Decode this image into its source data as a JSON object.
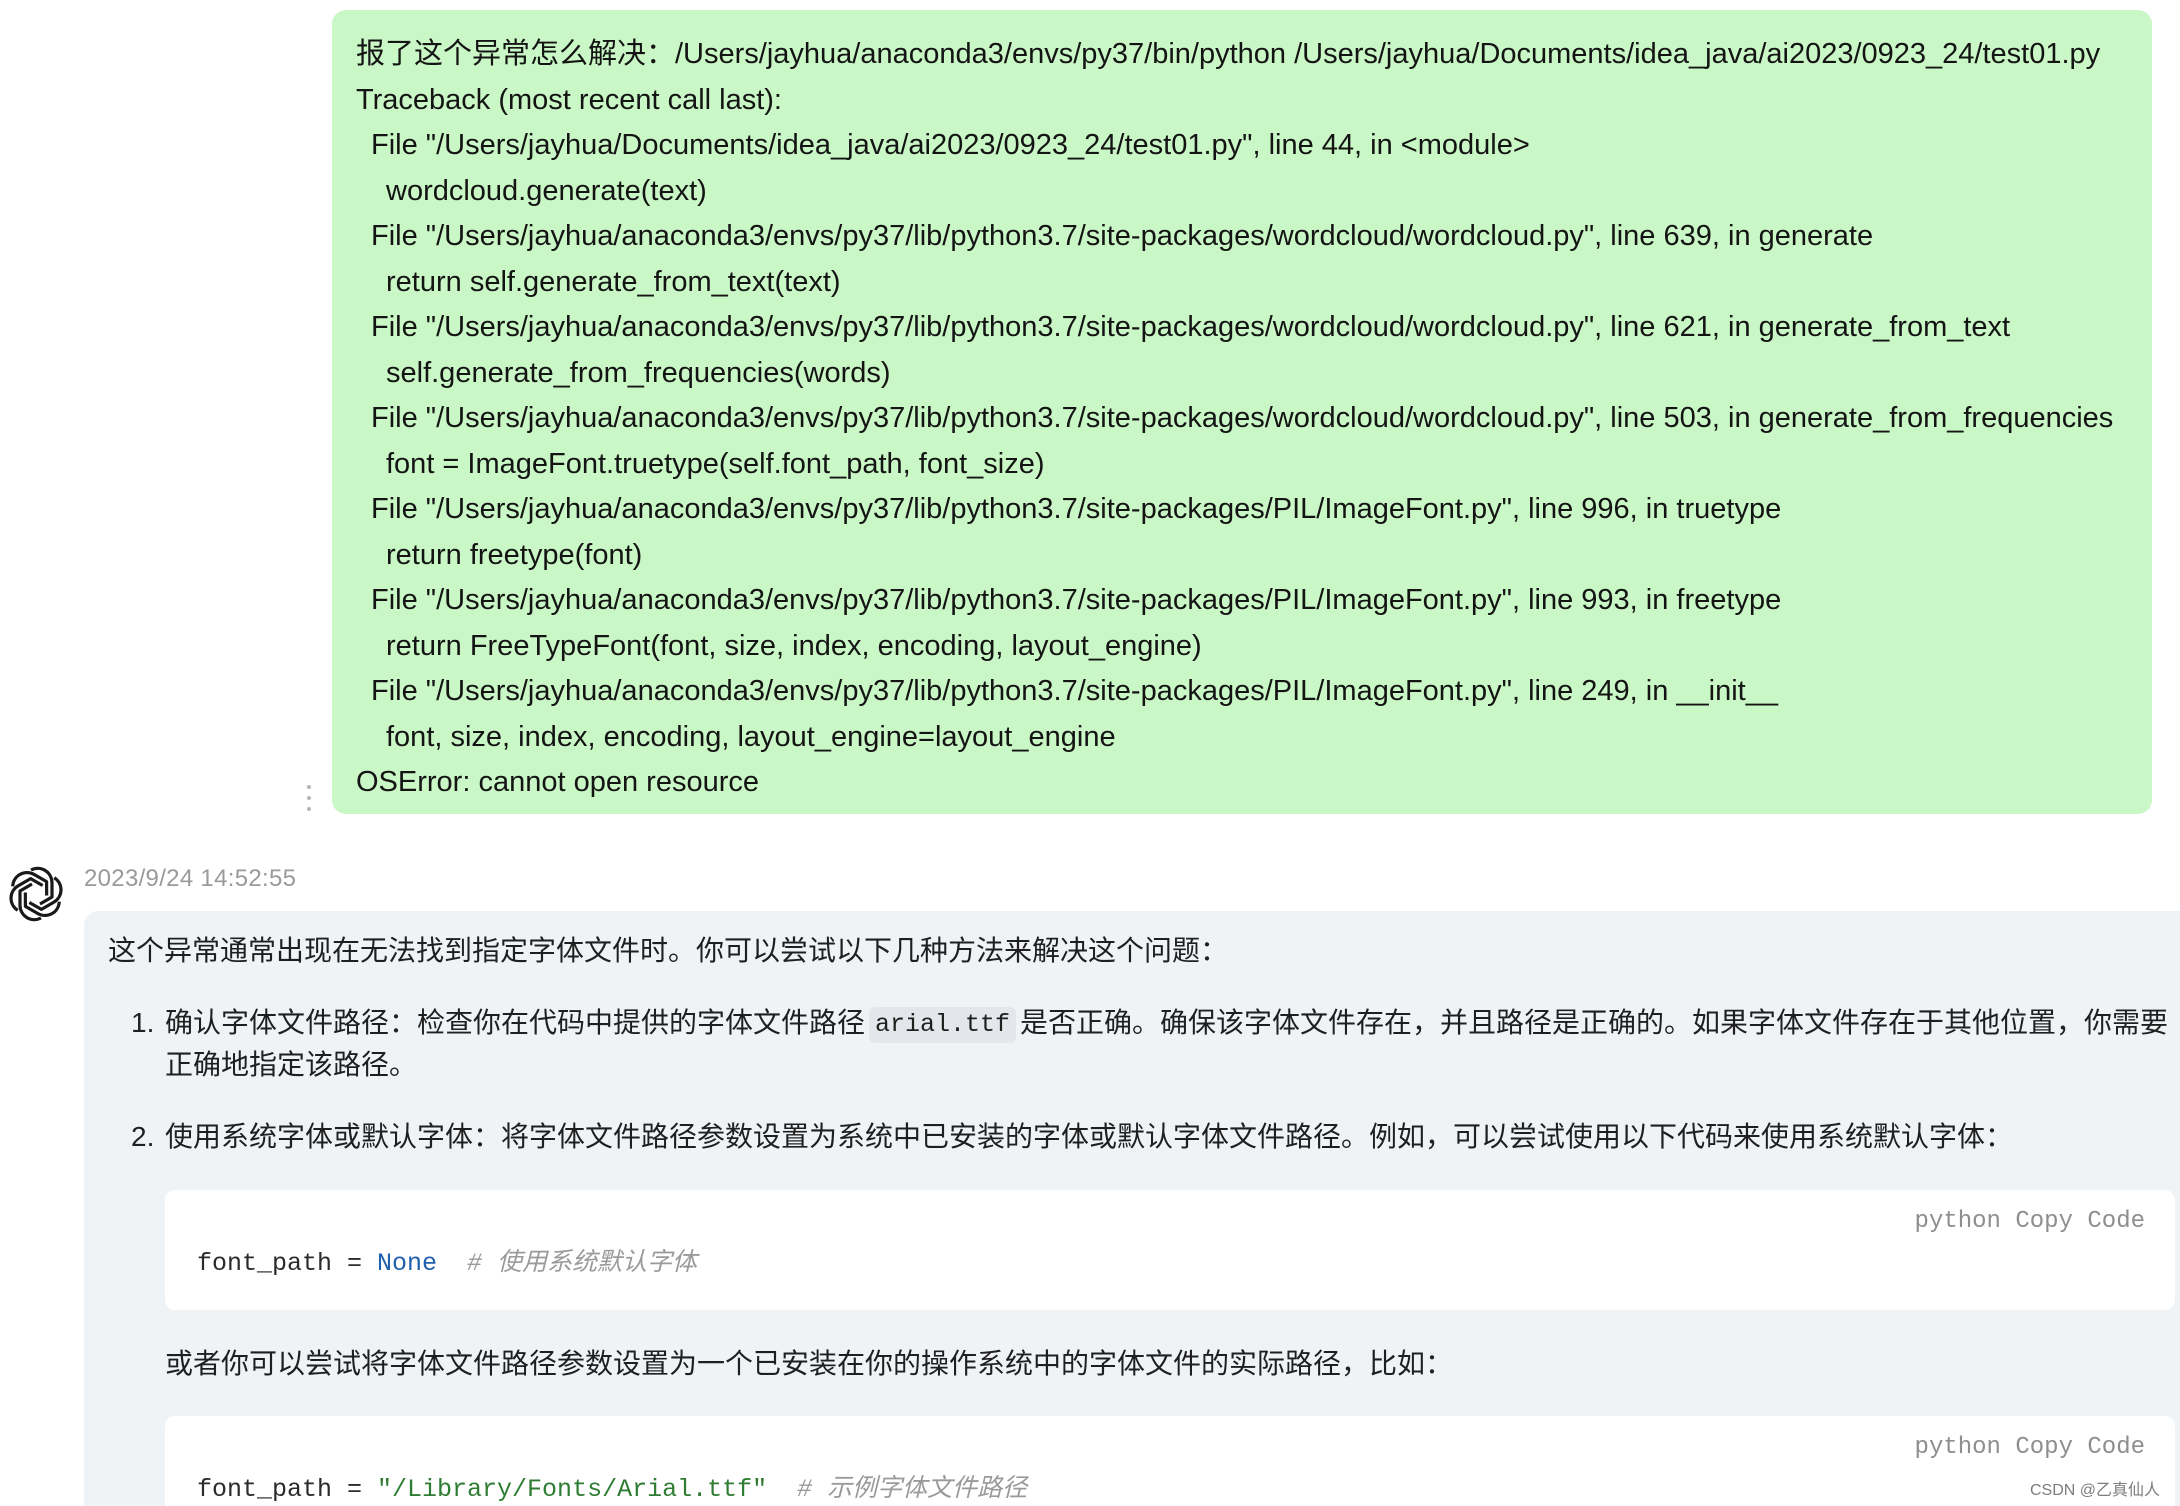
{
  "user_message": {
    "lines": [
      "报了这个异常怎么解决：/Users/jayhua/anaconda3/envs/py37/bin/python /Users/jayhua/Documents/idea_java/ai2023/0923_24/test01.py",
      "Traceback (most recent call last):",
      "File \"/Users/jayhua/Documents/idea_java/ai2023/0923_24/test01.py\", line 44, in <module>",
      "wordcloud.generate(text)",
      "File \"/Users/jayhua/anaconda3/envs/py37/lib/python3.7/site-packages/wordcloud/wordcloud.py\", line 639, in generate",
      "return self.generate_from_text(text)",
      "File \"/Users/jayhua/anaconda3/envs/py37/lib/python3.7/site-packages/wordcloud/wordcloud.py\", line 621, in generate_from_text",
      "self.generate_from_frequencies(words)",
      "File \"/Users/jayhua/anaconda3/envs/py37/lib/python3.7/site-packages/wordcloud/wordcloud.py\", line 503, in generate_from_frequencies",
      "font = ImageFont.truetype(self.font_path, font_size)",
      "File \"/Users/jayhua/anaconda3/envs/py37/lib/python3.7/site-packages/PIL/ImageFont.py\", line 996, in truetype",
      "return freetype(font)",
      "File \"/Users/jayhua/anaconda3/envs/py37/lib/python3.7/site-packages/PIL/ImageFont.py\", line 993, in freetype",
      "return FreeTypeFont(font, size, index, encoding, layout_engine)",
      "File \"/Users/jayhua/anaconda3/envs/py37/lib/python3.7/site-packages/PIL/ImageFont.py\", line 249, in __init__",
      "font, size, index, encoding, layout_engine=layout_engine",
      "OSError: cannot open resource"
    ]
  },
  "assistant": {
    "avatar_icon": "openai-logo-icon",
    "timestamp": "2023/9/24 14:52:55",
    "intro": "这个异常通常出现在无法找到指定字体文件时。你可以尝试以下几种方法来解决这个问题：",
    "item1": {
      "number": "1.",
      "text_before": "确认字体文件路径：检查你在代码中提供的字体文件路径",
      "code": "arial.ttf",
      "text_after": "是否正确。确保该字体文件存在，并且路径是正确的。如果字体文件存在于其他位置，你需要",
      "text_line2": "正确地指定该路径。"
    },
    "item2": {
      "number": "2.",
      "text": "使用系统字体或默认字体：将字体文件路径参数设置为系统中已安装的字体或默认字体文件路径。例如，可以尝试使用以下代码来使用系统默认字体："
    },
    "code_block_1": {
      "language": "python",
      "copy_label": "Copy Code",
      "var": "font_path = ",
      "value": "None",
      "comment": "  # 使用系统默认字体"
    },
    "paragraph": "或者你可以尝试将字体文件路径参数设置为一个已安装在你的操作系统中的字体文件的实际路径，比如：",
    "code_block_2": {
      "language": "python",
      "copy_label": "Copy Code",
      "var": "font_path = ",
      "value": "\"/Library/Fonts/Arial.ttf\"",
      "comment": "  # 示例字体文件路径"
    }
  },
  "watermark": "CSDN @乙真仙人",
  "colors": {
    "user_bubble": "#c9f7c5",
    "assistant_bubble": "#f0f3f6",
    "code_keyword": "#1f5fae",
    "code_string": "#2f7d32"
  }
}
